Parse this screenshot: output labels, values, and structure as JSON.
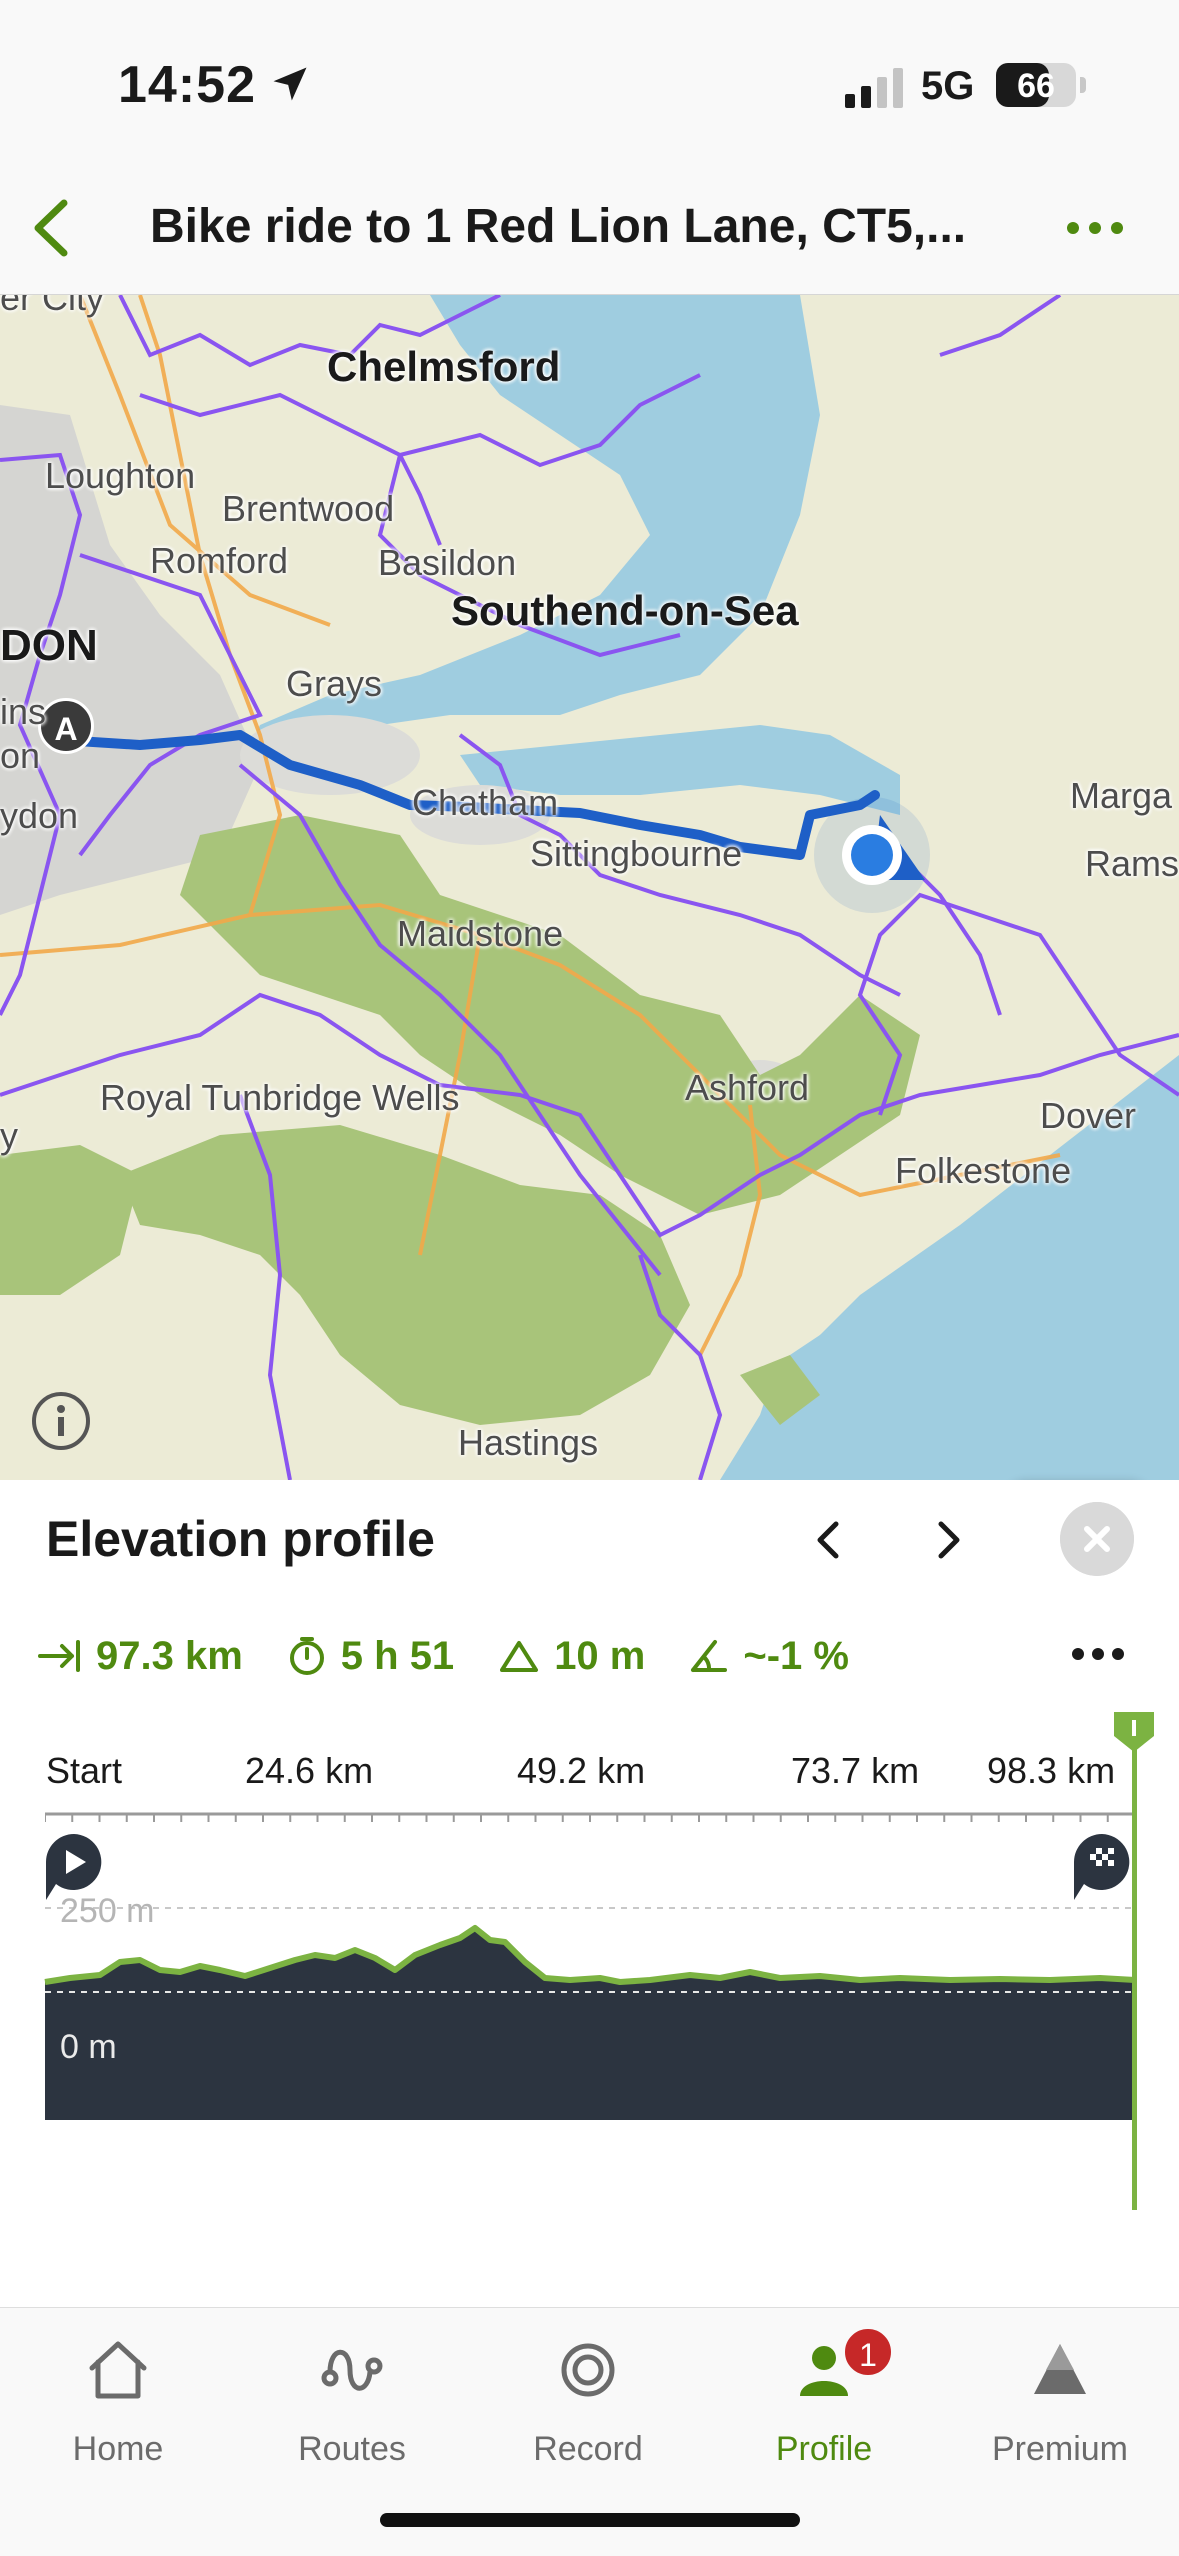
{
  "status_bar": {
    "time": "14:52",
    "network": "5G",
    "battery": "66",
    "battery_level": 0.66
  },
  "header": {
    "title": "Bike ride to 1 Red Lion Lane, CT5,..."
  },
  "map": {
    "start_marker": "A",
    "cities": {
      "chelmsford": "Chelmsford",
      "loughton": "Loughton",
      "brentwood": "Brentwood",
      "romford": "Romford",
      "basildon": "Basildon",
      "southend": "Southend-on-Sea",
      "london": "DON",
      "grays": "Grays",
      "chatham": "Chatham",
      "sittingbourne": "Sittingbourne",
      "maidstone": "Maidstone",
      "tunbridge": "Royal Tunbridge Wells",
      "ashford": "Ashford",
      "dover": "Dover",
      "folkestone": "Folkestone",
      "hastings": "Hastings",
      "margate": "Marga",
      "ramsgate": "Rams",
      "croydon": "ydon",
      "edge1": "ins",
      "edge2": "on",
      "edge3": "y",
      "top_left": "er City"
    },
    "colors": {
      "route": "#1e5fc7",
      "boundaries": "#8a55f0",
      "sea": "#9fcde0",
      "woodland": "#a8c47a",
      "land": "#ecebd6"
    }
  },
  "elevation": {
    "title": "Elevation profile",
    "stats": {
      "distance": "97.3 km",
      "duration": "5 h 51",
      "ascent": "10 m",
      "gradient": "~-1 %"
    },
    "tick_labels": [
      "Start",
      "24.6 km",
      "49.2 km",
      "73.7 km",
      "98.3 km"
    ],
    "y_labels": {
      "top": "250 m",
      "bottom": "0 m"
    }
  },
  "tabbar": {
    "home": "Home",
    "routes": "Routes",
    "record": "Record",
    "profile": "Profile",
    "profile_badge": "1",
    "premium": "Premium"
  }
}
